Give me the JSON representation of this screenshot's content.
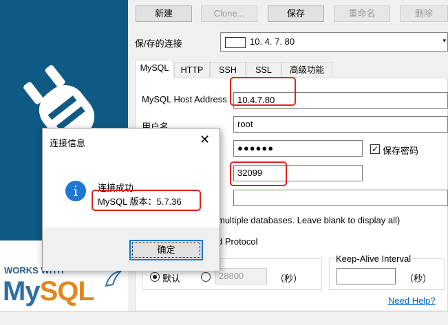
{
  "toolbar": {
    "new_label": "新建",
    "clone_label": "Clone...",
    "save_label": "保存",
    "rename_label": "重命名",
    "delete_label": "删除"
  },
  "saved_connection": {
    "label": "保/存的连接",
    "value": "10. 4. 7. 80"
  },
  "tabs": [
    {
      "label": "MySQL",
      "active": true
    },
    {
      "label": "HTTP"
    },
    {
      "label": "SSH"
    },
    {
      "label": "SSL"
    },
    {
      "label": "高级功能"
    }
  ],
  "form": {
    "host_label": "MySQL Host Address",
    "host_value": "10.4.7.80",
    "user_label": "用户名",
    "user_value": "root",
    "password_value": "●●●●●●",
    "save_password_label": "保存密码",
    "save_password_checked": true,
    "port_value": "32099",
    "databases_value": "",
    "databases_hint": " multiple databases. Leave blank to display all)",
    "protocol_hint": "d Protocol",
    "timeout_default_label": "默认",
    "timeout_value": "28800",
    "timeout_unit": "（秒）",
    "keepalive_label": "Keep-Alive Interval",
    "keepalive_value": "",
    "keepalive_unit": "（秒）",
    "help_link": "Need Help?"
  },
  "brand": {
    "works_text": "WORKS WITH",
    "logo_my": "My",
    "logo_sql": "SQL"
  },
  "dialog": {
    "title": "连接信息",
    "message_line1": "连接成功",
    "message_line2": "MySQL 版本：5.7.36",
    "ok_label": "确定"
  },
  "colors": {
    "brand_blue": "#0e5a84",
    "highlight_red": "#e3211c",
    "link_blue": "#0066cc",
    "info_blue": "#1e78d2"
  }
}
